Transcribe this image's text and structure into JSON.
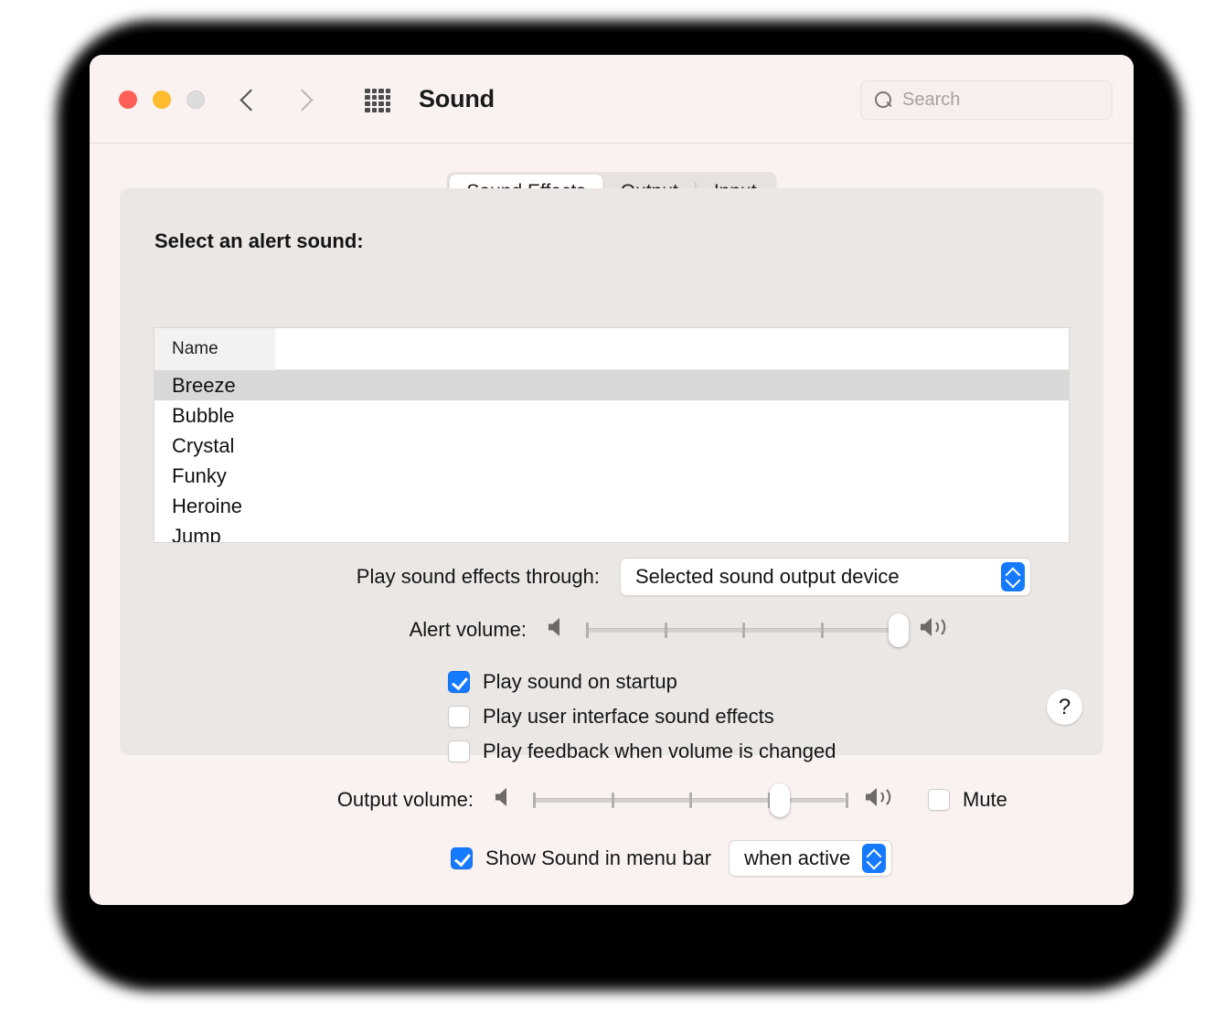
{
  "window": {
    "title": "Sound",
    "traffic_lights": [
      "close-red",
      "minimize-yellow",
      "zoom-gray-disabled"
    ],
    "back_icon": "chevron-left-icon",
    "forward_icon": "chevron-right-icon",
    "grid_icon": "show-all-grid-icon"
  },
  "search": {
    "placeholder": "Search",
    "value": "",
    "icon": "search-icon"
  },
  "tabs": [
    {
      "label": "Sound Effects",
      "selected": true
    },
    {
      "label": "Output",
      "selected": false
    },
    {
      "label": "Input",
      "selected": false
    }
  ],
  "panel": {
    "title": "Select an alert sound:",
    "list": {
      "columns": [
        "Name"
      ],
      "rows": [
        {
          "name": "Breeze",
          "selected": true
        },
        {
          "name": "Bubble",
          "selected": false
        },
        {
          "name": "Crystal",
          "selected": false
        },
        {
          "name": "Funky",
          "selected": false
        },
        {
          "name": "Heroine",
          "selected": false
        },
        {
          "name": "Jump",
          "selected": false
        }
      ]
    },
    "play_through": {
      "label": "Play sound effects through:",
      "value": "Selected sound output device",
      "stepper_icon": "chevron-up-down-icon"
    },
    "alert_volume": {
      "label": "Alert volume:",
      "value_percent": 100,
      "min_icon": "speaker-quiet-icon",
      "max_icon": "speaker-loud-icon",
      "ticks": 5
    },
    "checkboxes": [
      {
        "label": "Play sound on startup",
        "checked": true
      },
      {
        "label": "Play user interface sound effects",
        "checked": false
      },
      {
        "label": "Play feedback when volume is changed",
        "checked": false
      }
    ],
    "help": {
      "label": "?",
      "icon": "help-question-icon"
    }
  },
  "bottom": {
    "output_volume": {
      "label": "Output volume:",
      "value_percent": 79,
      "min_icon": "speaker-quiet-icon",
      "max_icon": "speaker-loud-icon",
      "ticks": 5
    },
    "mute": {
      "label": "Mute",
      "checked": false
    },
    "menu_bar": {
      "label": "Show Sound in menu bar",
      "checked": true,
      "popup_value": "when active",
      "stepper_icon": "chevron-up-down-icon"
    }
  },
  "colors": {
    "accent": "#157aff",
    "window_bg": "#f9f2f1",
    "panel_bg": "#ebe7e5",
    "selected_row": "#d8d8d8",
    "traffic_red": "#fe5f57",
    "traffic_yellow": "#febc2e",
    "traffic_gray": "#dcdcdc"
  }
}
